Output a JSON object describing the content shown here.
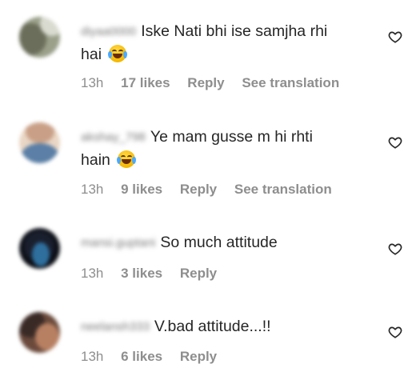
{
  "comments": [
    {
      "username": "diyaa0000",
      "text": "Iske Nati bhi ise samjha rhi",
      "text_line2": "hai",
      "emoji": "laughing-tears-emoji",
      "time": "13h",
      "likes": "17 likes",
      "reply": "Reply",
      "translation": "See translation",
      "avatar_colors": [
        "#6b6e5a",
        "#9aa08a",
        "#d9dbd0"
      ]
    },
    {
      "username": "akshay_798",
      "text": "Ye mam gusse m hi rhti",
      "text_line2": "hain",
      "emoji": "laughing-tears-emoji",
      "time": "13h",
      "likes": "9 likes",
      "reply": "Reply",
      "translation": "See translation",
      "avatar_colors": [
        "#c9a087",
        "#5b7fa6",
        "#e9d6c4"
      ]
    },
    {
      "username": "mansi.guptani",
      "text": "So much attitude",
      "time": "13h",
      "likes": "3 likes",
      "reply": "Reply",
      "avatar_colors": [
        "#1a1f2e",
        "#2e6f9e",
        "#0c0f16"
      ]
    },
    {
      "username": "neelansh333",
      "text": "V.bad attitude...!!",
      "time": "13h",
      "likes": "6 likes",
      "reply": "Reply",
      "avatar_colors": [
        "#3a2a26",
        "#b88062",
        "#6b4a3c"
      ]
    }
  ]
}
